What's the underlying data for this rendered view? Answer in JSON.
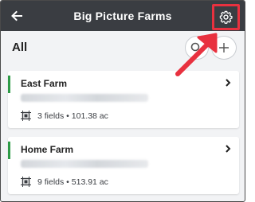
{
  "header": {
    "title": "Big Picture Farms",
    "back_icon": "arrow-left-icon",
    "settings_icon": "gear-icon"
  },
  "section": {
    "title": "All",
    "search_icon": "search-icon",
    "add_icon": "plus-icon"
  },
  "farms": [
    {
      "name": "East Farm",
      "stats": "3 fields • 101.38 ac"
    },
    {
      "name": "Home Farm",
      "stats": "9 fields • 513.91 ac"
    }
  ],
  "colors": {
    "header_bg": "#3a3d42",
    "accent_green": "#2e9b47",
    "annotation_red": "#e8313f"
  }
}
